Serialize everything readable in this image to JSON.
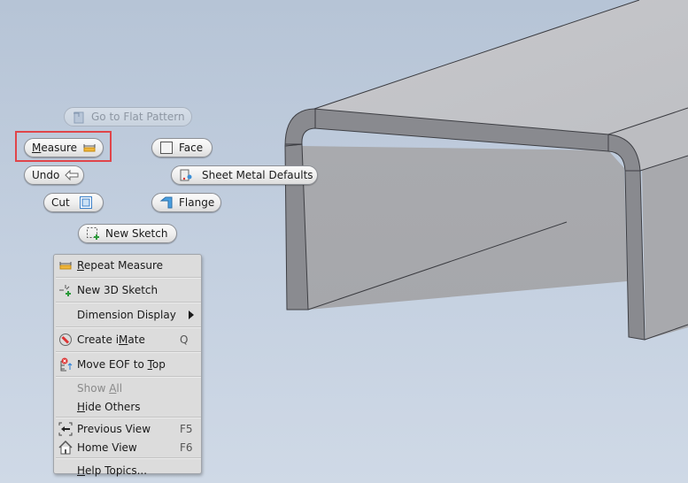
{
  "marking_menu": {
    "buttons": [
      {
        "id": "go-to-flat-pattern",
        "label": "Go to Flat Pattern",
        "icon": "flat-pattern-icon",
        "enabled": false
      },
      {
        "id": "measure",
        "label": "Measure",
        "underline": "M",
        "icon": "ruler-icon",
        "enabled": true,
        "highlighted": true
      },
      {
        "id": "face",
        "label": "Face",
        "icon": "face-icon",
        "enabled": true
      },
      {
        "id": "undo",
        "label": "Undo",
        "icon": "undo-arrow-icon",
        "enabled": true
      },
      {
        "id": "sheet-metal-defaults",
        "label": "Sheet Metal Defaults",
        "icon": "sheet-metal-defaults-icon",
        "enabled": true
      },
      {
        "id": "cut",
        "label": "Cut",
        "icon": "cut-icon",
        "enabled": true
      },
      {
        "id": "flange",
        "label": "Flange",
        "icon": "flange-icon",
        "enabled": true
      },
      {
        "id": "new-sketch",
        "label": "New Sketch",
        "icon": "new-sketch-icon",
        "enabled": true
      }
    ],
    "highlight_color": "#e0454a"
  },
  "context_menu": {
    "items": [
      {
        "label": "Repeat Measure",
        "underline_index": 0,
        "icon": "ruler-icon",
        "shortcut": ""
      },
      {
        "label": "New 3D Sketch",
        "icon": "new-3d-sketch-icon",
        "shortcut": ""
      },
      {
        "label": "Dimension Display",
        "icon": "",
        "shortcut": "",
        "submenu": true
      },
      {
        "label": "Create iMate",
        "icon": "imate-icon",
        "shortcut": "Q"
      },
      {
        "label": "Move EOF to Top",
        "icon": "move-eof-icon",
        "shortcut": ""
      },
      {
        "label": "Show All",
        "icon": "",
        "shortcut": "",
        "disabled": true
      },
      {
        "label": "Hide Others",
        "icon": "",
        "shortcut": ""
      },
      {
        "label": "Previous View",
        "icon": "previous-view-icon",
        "shortcut": "F5"
      },
      {
        "label": "Home View",
        "icon": "home-view-icon",
        "shortcut": "F6"
      },
      {
        "label": "Help Topics...",
        "icon": "",
        "shortcut": ""
      }
    ]
  },
  "viewport": {
    "background_top": "#b6c4d6",
    "background_bottom": "#cfd9e6",
    "model": "sheet metal channel part"
  }
}
